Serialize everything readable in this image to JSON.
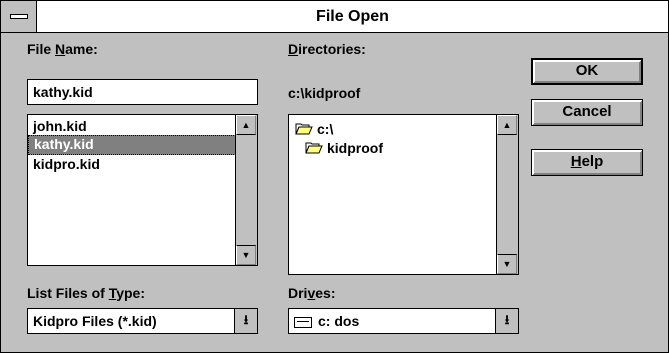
{
  "window": {
    "title": "File Open"
  },
  "file_name": {
    "label_prefix": "File ",
    "label_hotkey": "N",
    "label_suffix": "ame:",
    "value": "kathy.kid",
    "files": [
      "john.kid",
      "kathy.kid",
      "kidpro.kid"
    ],
    "selected_index": 1
  },
  "directories": {
    "label_hotkey": "D",
    "label_suffix": "irectories:",
    "current_path": "c:\\kidproof",
    "tree": [
      {
        "name": "c:\\",
        "icon": "open-folder-icon"
      },
      {
        "name": "kidproof",
        "icon": "open-folder-icon"
      }
    ]
  },
  "file_type": {
    "label_prefix": "List Files of ",
    "label_hotkey": "T",
    "label_suffix": "ype:",
    "value": "Kidpro Files (*.kid)"
  },
  "drives": {
    "label_prefix": "Dri",
    "label_hotkey": "v",
    "label_suffix": "es:",
    "value": "c: dos",
    "icon": "drive-icon"
  },
  "buttons": {
    "ok": "OK",
    "cancel": "Cancel",
    "help_hotkey": "H",
    "help_suffix": "elp"
  },
  "icons": {
    "scroll_up": "▲",
    "scroll_down": "▼",
    "dropdown": "⭳"
  },
  "colors": {
    "face": "#c0c0c0",
    "selection": "#808080"
  }
}
